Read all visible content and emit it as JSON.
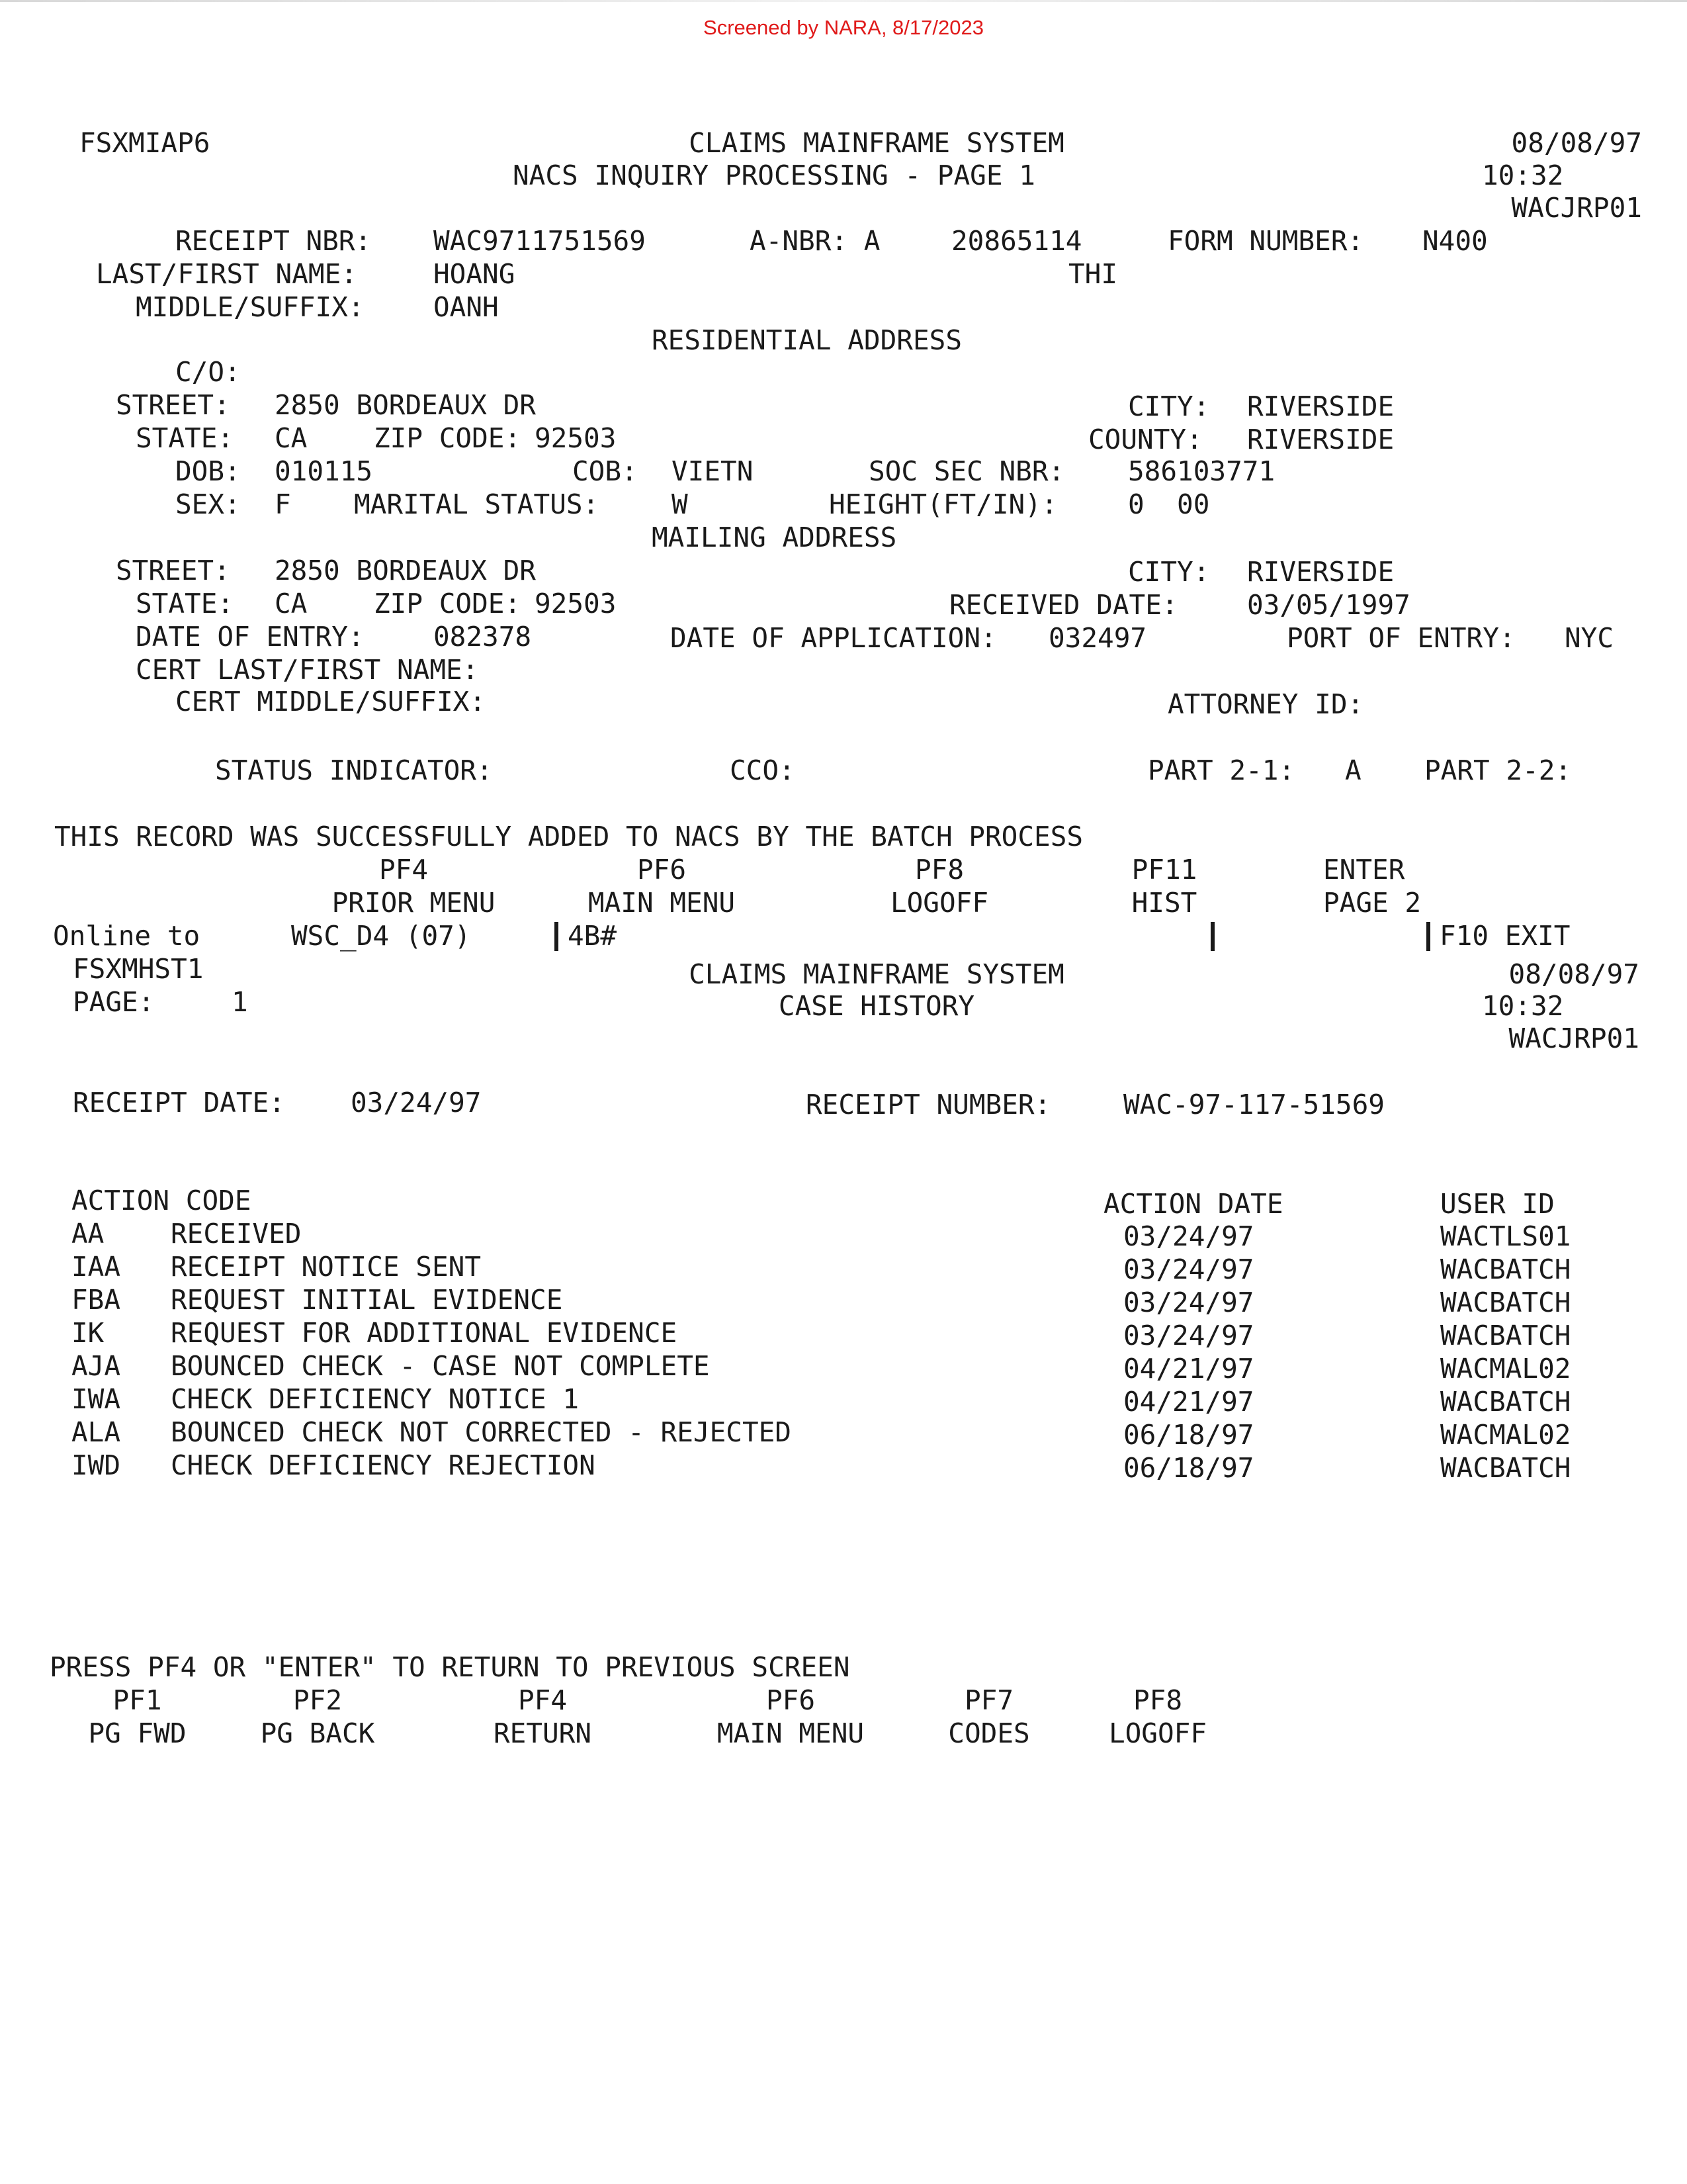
{
  "stamp": "Screened by NARA, 8/17/2023",
  "screen1": {
    "program_id": "FSXMIAP6",
    "title": "CLAIMS MAINFRAME SYSTEM",
    "subtitle": "NACS INQUIRY PROCESSING - PAGE 1",
    "date": "08/08/97",
    "time": "10:32",
    "terminal": "WACJRP01",
    "receipt_nbr_label": "RECEIPT NBR:",
    "receipt_nbr": "WAC9711751569",
    "a_nbr_label": "A-NBR: A",
    "a_nbr": "20865114",
    "form_number_label": "FORM NUMBER:",
    "form_number": "N400",
    "last_first_label": "LAST/FIRST NAME:",
    "last_name": "HOANG",
    "first_name": "THI",
    "middle_suffix_label": "MIDDLE/SUFFIX:",
    "middle_name": "OANH",
    "residential_header": "RESIDENTIAL ADDRESS",
    "co_label": "C/O:",
    "res_street_label": "STREET:",
    "res_street": "2850 BORDEAUX DR",
    "res_city_label": "CITY:",
    "res_city": "RIVERSIDE",
    "res_state_label": "STATE:",
    "res_state": "CA",
    "res_zip_label": "ZIP CODE:",
    "res_zip": "92503",
    "county_label": "COUNTY:",
    "county": "RIVERSIDE",
    "dob_label": "DOB:",
    "dob": "010115",
    "cob_label": "COB:",
    "cob": "VIETN",
    "ssn_label": "SOC SEC NBR:",
    "ssn": "586103771",
    "sex_label": "SEX:",
    "sex": "F",
    "marital_label": "MARITAL STATUS:",
    "marital": "W",
    "height_label": "HEIGHT(FT/IN):",
    "height": "0  00",
    "mailing_header": "MAILING ADDRESS",
    "mail_street_label": "STREET:",
    "mail_street": "2850 BORDEAUX DR",
    "mail_city_label": "CITY:",
    "mail_city": "RIVERSIDE",
    "mail_state_label": "STATE:",
    "mail_state": "CA",
    "mail_zip_label": "ZIP CODE:",
    "mail_zip": "92503",
    "received_date_label": "RECEIVED DATE:",
    "received_date": "03/05/1997",
    "date_entry_label": "DATE OF ENTRY:",
    "date_entry": "082378",
    "date_application_label": "DATE OF APPLICATION:",
    "date_application": "032497",
    "port_entry_label": "PORT OF ENTRY:",
    "port_entry": "NYC",
    "cert_last_first_label": "CERT LAST/FIRST NAME:",
    "cert_middle_suffix_label": "CERT MIDDLE/SUFFIX:",
    "attorney_id_label": "ATTORNEY ID:",
    "status_indicator_label": "STATUS INDICATOR:",
    "cco_label": "CCO:",
    "part21_label": "PART 2-1:",
    "part21": "A",
    "part22_label": "PART 2-2:",
    "message": "THIS RECORD WAS SUCCESSFULLY ADDED TO NACS BY THE BATCH PROCESS",
    "function_keys": [
      {
        "key": "PF4",
        "label": "PRIOR MENU"
      },
      {
        "key": "PF6",
        "label": "MAIN MENU"
      },
      {
        "key": "PF8",
        "label": "LOGOFF"
      },
      {
        "key": "PF11",
        "label": "HIST"
      },
      {
        "key": "ENTER",
        "label": "PAGE 2"
      }
    ]
  },
  "status_line": {
    "online_to": "Online to",
    "session": "WSC_D4 (07)",
    "field": "4B#",
    "exit": "F10 EXIT"
  },
  "screen2": {
    "program_id": "FSXMHST1",
    "page_label": "PAGE:",
    "page_number": "1",
    "title": "CLAIMS MAINFRAME SYSTEM",
    "subtitle": "CASE HISTORY",
    "date": "08/08/97",
    "time": "10:32",
    "terminal": "WACJRP01",
    "receipt_date_label": "RECEIPT DATE:",
    "receipt_date": "03/24/97",
    "receipt_number_label": "RECEIPT NUMBER:",
    "receipt_number": "WAC-97-117-51569",
    "col_action_code": "ACTION CODE",
    "col_action_date": "ACTION DATE",
    "col_user_id": "USER ID",
    "actions": [
      {
        "code": "AA",
        "description": "RECEIVED",
        "date": "03/24/97",
        "user": "WACTLS01"
      },
      {
        "code": "IAA",
        "description": "RECEIPT NOTICE SENT",
        "date": "03/24/97",
        "user": "WACBATCH"
      },
      {
        "code": "FBA",
        "description": "REQUEST INITIAL EVIDENCE",
        "date": "03/24/97",
        "user": "WACBATCH"
      },
      {
        "code": "IK",
        "description": "REQUEST FOR ADDITIONAL EVIDENCE",
        "date": "03/24/97",
        "user": "WACBATCH"
      },
      {
        "code": "AJA",
        "description": "BOUNCED CHECK - CASE NOT COMPLETE",
        "date": "04/21/97",
        "user": "WACMAL02"
      },
      {
        "code": "IWA",
        "description": "CHECK DEFICIENCY NOTICE 1",
        "date": "04/21/97",
        "user": "WACBATCH"
      },
      {
        "code": "ALA",
        "description": "BOUNCED CHECK NOT CORRECTED - REJECTED",
        "date": "06/18/97",
        "user": "WACMAL02"
      },
      {
        "code": "IWD",
        "description": "CHECK DEFICIENCY REJECTION",
        "date": "06/18/97",
        "user": "WACBATCH"
      }
    ],
    "instruction": "PRESS PF4 OR \"ENTER\" TO RETURN TO PREVIOUS SCREEN",
    "function_keys": [
      {
        "key": "PF1",
        "label": "PG FWD"
      },
      {
        "key": "PF2",
        "label": "PG BACK"
      },
      {
        "key": "PF4",
        "label": "RETURN"
      },
      {
        "key": "PF6",
        "label": "MAIN MENU"
      },
      {
        "key": "PF7",
        "label": "CODES"
      },
      {
        "key": "PF8",
        "label": "LOGOFF"
      }
    ]
  }
}
